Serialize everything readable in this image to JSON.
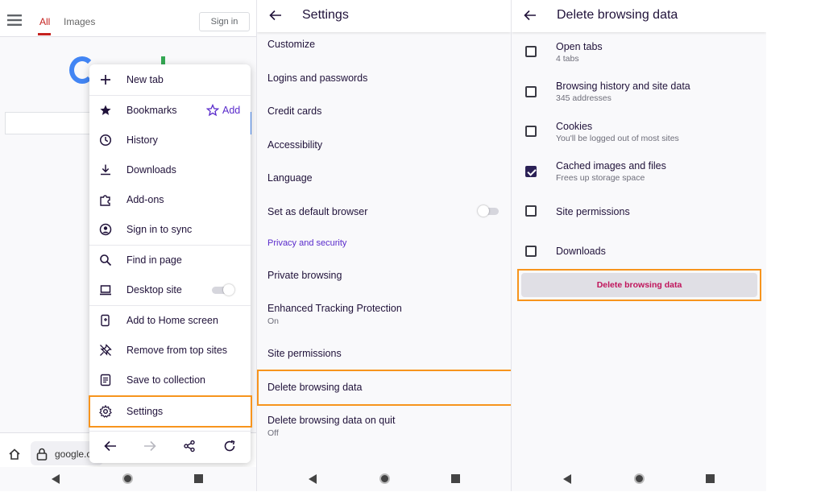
{
  "panel1": {
    "tabs": {
      "all": "All",
      "images": "Images"
    },
    "sign_in": "Sign in",
    "url": "google.c",
    "menu": {
      "new_tab": "New tab",
      "bookmarks": "Bookmarks",
      "add": "Add",
      "history": "History",
      "downloads": "Downloads",
      "addons": "Add-ons",
      "sign_in_sync": "Sign in to sync",
      "find_in_page": "Find in page",
      "desktop_site": "Desktop site",
      "add_home": "Add to Home screen",
      "remove_top": "Remove from top sites",
      "save_collection": "Save to collection",
      "settings": "Settings"
    }
  },
  "panel2": {
    "title": "Settings",
    "items": {
      "customize": "Customize",
      "logins": "Logins and passwords",
      "credit_cards": "Credit cards",
      "accessibility": "Accessibility",
      "language": "Language",
      "default_browser": "Set as default browser",
      "section_privacy": "Privacy and security",
      "private_browsing": "Private browsing",
      "etp": "Enhanced Tracking Protection",
      "etp_status": "On",
      "site_permissions": "Site permissions",
      "delete_data": "Delete browsing data",
      "delete_on_quit": "Delete browsing data on quit",
      "delete_on_quit_status": "Off"
    }
  },
  "panel3": {
    "title": "Delete browsing data",
    "options": [
      {
        "title": "Open tabs",
        "sub": "4 tabs",
        "checked": false
      },
      {
        "title": "Browsing history and site data",
        "sub": "345 addresses",
        "checked": false
      },
      {
        "title": "Cookies",
        "sub": "You'll be logged out of most sites",
        "checked": false
      },
      {
        "title": "Cached images and files",
        "sub": "Frees up storage space",
        "checked": true
      },
      {
        "title": "Site permissions",
        "sub": "",
        "checked": false
      },
      {
        "title": "Downloads",
        "sub": "",
        "checked": false
      }
    ],
    "button": "Delete browsing data"
  },
  "colors": {
    "accent_purple": "#592acb",
    "highlight_orange": "#f7941d",
    "delete_text": "#c0145b",
    "checkbox_checked": "#2b2156"
  }
}
